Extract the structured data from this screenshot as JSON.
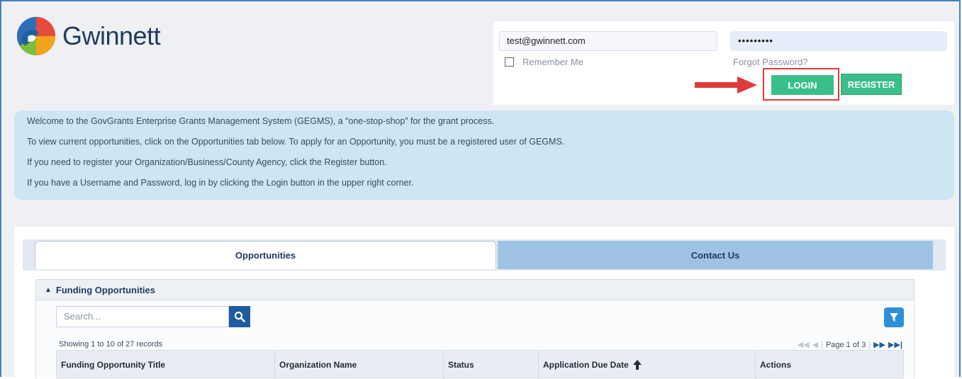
{
  "brand": {
    "name": "Gwinnett"
  },
  "login": {
    "email_value": "test@gwinnett.com",
    "password_value": "•••••••••",
    "remember_label": "Remember Me",
    "forgot_label": "Forgot Password?",
    "login_label": "LOGIN",
    "register_label": "REGISTER"
  },
  "welcome": {
    "lines": [
      "Welcome to the GovGrants Enterprise Grants Management System (GEGMS), a “one-stop-shop” for the grant process.",
      "To view current opportunities, click on the Opportunities tab below. To apply for an Opportunity, you must be a registered user of GEGMS.",
      "If you need to register your Organization/Business/County Agency, click the Register button.",
      "If you have a Username and Password, log in by clicking the Login button in the upper right corner."
    ]
  },
  "tabs": [
    {
      "label": "Opportunities"
    },
    {
      "label": "Contact Us"
    }
  ],
  "section": {
    "title": "Funding Opportunities",
    "search_placeholder": "Search...",
    "records_text": "Showing 1 to 10 of 27 records",
    "page_text": "Page 1 of 3",
    "columns": [
      "Funding Opportunity Title",
      "Organization Name",
      "Status",
      "Application Due Date",
      "Actions"
    ],
    "sort_arrow": "🡅"
  },
  "colors": {
    "accent": "#3bbf8a",
    "highlight": "#e0393a",
    "primary": "#1f5c9e"
  }
}
